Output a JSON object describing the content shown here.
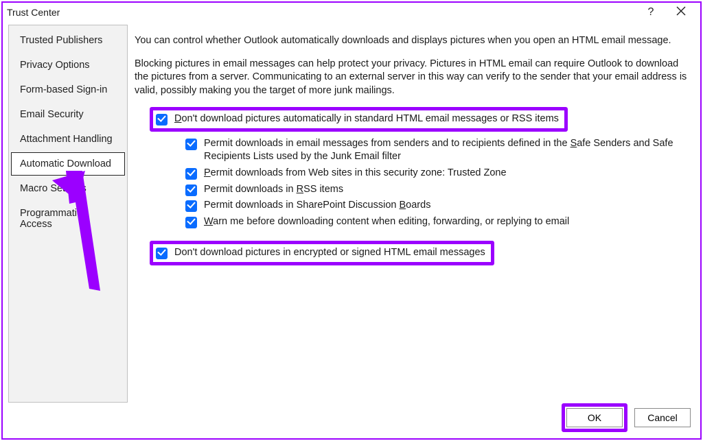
{
  "window": {
    "title": "Trust Center"
  },
  "sidebar": {
    "items": [
      {
        "label": "Trusted Publishers"
      },
      {
        "label": "Privacy Options"
      },
      {
        "label": "Form-based Sign-in"
      },
      {
        "label": "Email Security"
      },
      {
        "label": "Attachment Handling"
      },
      {
        "label": "Automatic Download"
      },
      {
        "label": "Macro Settings"
      },
      {
        "label": "Programmatic Access"
      }
    ],
    "selected_index": 5
  },
  "content": {
    "intro1": "You can control whether Outlook automatically downloads and displays pictures when you open an HTML email message.",
    "intro2": "Blocking pictures in email messages can help protect your privacy. Pictures in HTML email can require Outlook to download the pictures from a server. Communicating to an external server in this way can verify to the sender that your email address is valid, possibly making you the target of more junk mailings.",
    "opt_main": {
      "pre": "D",
      "rest": "on't download pictures automatically in standard HTML email messages or RSS items",
      "checked": true
    },
    "sub1": {
      "text_pre": "Permit downloads in email messages from senders and to recipients defined in the ",
      "u": "S",
      "text_mid": "afe Senders and Safe Recipients Lists used by the Junk Email filter",
      "checked": true
    },
    "sub2": {
      "u": "P",
      "rest": "ermit downloads from Web sites in this security zone: Trusted Zone",
      "checked": true
    },
    "sub3": {
      "pre": "Permit downloads in ",
      "u": "R",
      "rest": "SS items",
      "checked": true
    },
    "sub4": {
      "pre": "Permit downloads in SharePoint Discussion ",
      "u": "B",
      "rest": "oards",
      "checked": true
    },
    "sub5": {
      "u": "W",
      "rest": "arn me before downloading content when editing, forwarding, or replying to email",
      "checked": true
    },
    "opt_enc": {
      "text": "Don't download pictures in encrypted or signed HTML email messages",
      "checked": true
    }
  },
  "footer": {
    "ok": "OK",
    "cancel": "Cancel"
  }
}
